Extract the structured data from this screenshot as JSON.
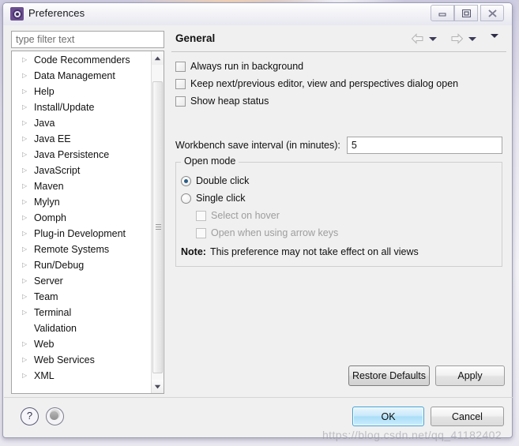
{
  "window": {
    "title": "Preferences",
    "app_icon": "gear-icon",
    "buttons": {
      "minimize": "minimize-icon",
      "maximize": "maximize-icon",
      "close": "close-icon"
    }
  },
  "filter": {
    "placeholder": "type filter text",
    "value": ""
  },
  "tree": {
    "items": [
      {
        "label": "Code Recommenders",
        "expandable": true
      },
      {
        "label": "Data Management",
        "expandable": true
      },
      {
        "label": "Help",
        "expandable": true
      },
      {
        "label": "Install/Update",
        "expandable": true
      },
      {
        "label": "Java",
        "expandable": true
      },
      {
        "label": "Java EE",
        "expandable": true
      },
      {
        "label": "Java Persistence",
        "expandable": true
      },
      {
        "label": "JavaScript",
        "expandable": true
      },
      {
        "label": "Maven",
        "expandable": true
      },
      {
        "label": "Mylyn",
        "expandable": true
      },
      {
        "label": "Oomph",
        "expandable": true
      },
      {
        "label": "Plug-in Development",
        "expandable": true
      },
      {
        "label": "Remote Systems",
        "expandable": true
      },
      {
        "label": "Run/Debug",
        "expandable": true
      },
      {
        "label": "Server",
        "expandable": true
      },
      {
        "label": "Team",
        "expandable": true
      },
      {
        "label": "Terminal",
        "expandable": true
      },
      {
        "label": "Validation",
        "expandable": false
      },
      {
        "label": "Web",
        "expandable": true
      },
      {
        "label": "Web Services",
        "expandable": true
      },
      {
        "label": "XML",
        "expandable": true
      }
    ],
    "arrow_glyph": "▷"
  },
  "panel": {
    "title": "General",
    "nav": {
      "back": "back-arrow-icon",
      "back_menu": "chevron-down-icon",
      "forward": "forward-arrow-icon",
      "forward_menu": "chevron-down-icon",
      "menu": "chevron-down-icon"
    },
    "checkboxes": [
      {
        "label": "Always run in background",
        "checked": false,
        "enabled": true
      },
      {
        "label": "Keep next/previous editor, view and perspectives dialog open",
        "checked": false,
        "enabled": true
      },
      {
        "label": "Show heap status",
        "checked": false,
        "enabled": true
      }
    ],
    "interval": {
      "label": "Workbench save interval (in minutes):",
      "value": "5"
    },
    "open_mode": {
      "legend": "Open mode",
      "radios": [
        {
          "label": "Double click",
          "selected": true
        },
        {
          "label": "Single click",
          "selected": false
        }
      ],
      "sub_checkboxes": [
        {
          "label": "Select on hover",
          "checked": false,
          "enabled": false
        },
        {
          "label": "Open when using arrow keys",
          "checked": false,
          "enabled": false
        }
      ],
      "note_label": "Note:",
      "note_text": "This preference may not take effect on all views"
    },
    "restore_defaults": "Restore Defaults",
    "apply": "Apply"
  },
  "footer": {
    "help_icon": "question-mark-icon",
    "help_glyph": "?",
    "nav_icon": "circle-icon",
    "ok": "OK",
    "cancel": "Cancel"
  },
  "watermark": "https://blog.csdn.net/qq_41182402"
}
